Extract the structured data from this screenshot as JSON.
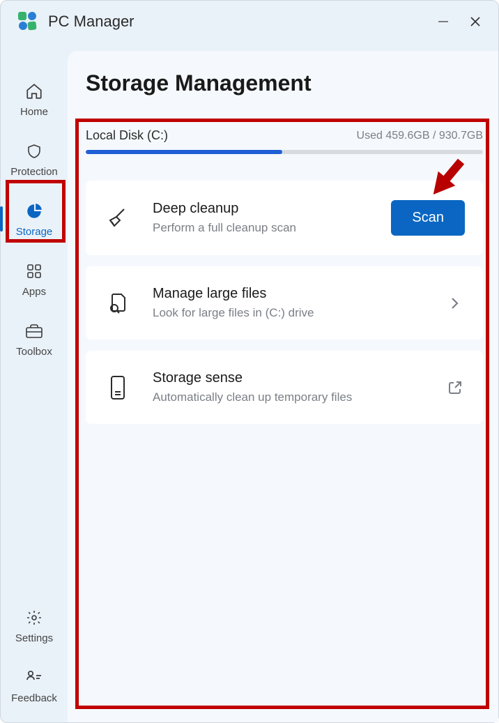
{
  "app": {
    "title": "PC Manager"
  },
  "sidebar": {
    "home": "Home",
    "protection": "Protection",
    "storage": "Storage",
    "apps": "Apps",
    "toolbox": "Toolbox",
    "settings": "Settings",
    "feedback": "Feedback"
  },
  "page": {
    "title": "Storage Management",
    "disk_name": "Local Disk (C:)",
    "disk_usage": "Used 459.6GB / 930.7GB",
    "disk_used_pct": 49.4
  },
  "cards": {
    "cleanup": {
      "title": "Deep cleanup",
      "sub": "Perform a full cleanup scan",
      "button": "Scan"
    },
    "large": {
      "title": "Manage large files",
      "sub": "Look for large files in (C:) drive"
    },
    "sense": {
      "title": "Storage sense",
      "sub": "Automatically clean up temporary files"
    }
  }
}
